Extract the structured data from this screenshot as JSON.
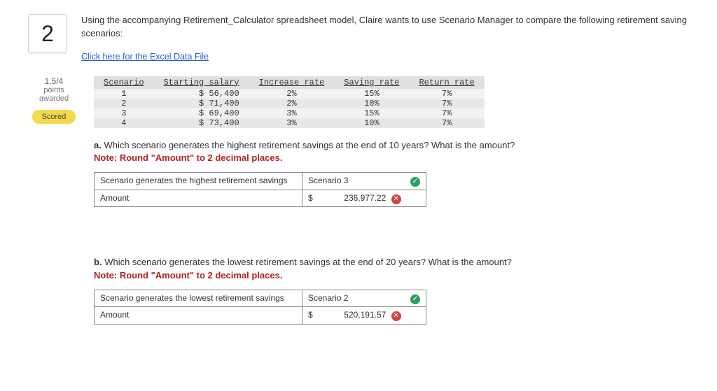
{
  "question_number": "2",
  "intro": "Using the accompanying Retirement_Calculator spreadsheet model, Claire wants to use Scenario Manager to compare the following retirement saving scenarios:",
  "excel_link": "Click here for the Excel Data File",
  "points": {
    "value": "1.5/4",
    "label": "points awarded"
  },
  "scored_label": "Scored",
  "scenario_table": {
    "headers": [
      "Scenario",
      "Starting salary",
      "Increase rate",
      "Saving rate",
      "Return rate"
    ],
    "rows": [
      {
        "n": "1",
        "sal": "$ 56,400",
        "inc": "2%",
        "sav": "15%",
        "ret": "7%"
      },
      {
        "n": "2",
        "sal": "$ 71,400",
        "inc": "2%",
        "sav": "10%",
        "ret": "7%"
      },
      {
        "n": "3",
        "sal": "$ 69,400",
        "inc": "3%",
        "sav": "15%",
        "ret": "7%"
      },
      {
        "n": "4",
        "sal": "$ 73,400",
        "inc": "3%",
        "sav": "10%",
        "ret": "7%"
      }
    ]
  },
  "part_a": {
    "label": "a.",
    "text": "Which scenario generates the highest retirement savings at the end of 10 years? What is the amount?",
    "note": "Note: Round \"Amount\" to 2 decimal places.",
    "rows": {
      "desc1": "Scenario generates the highest retirement savings",
      "val1": "Scenario 3",
      "val1_ok": true,
      "desc2": "Amount",
      "currency": "$",
      "val2": "236,977.22",
      "val2_ok": false
    }
  },
  "part_b": {
    "label": "b.",
    "text": "Which scenario generates the lowest retirement savings at the end of 20 years? What is the amount?",
    "note": "Note: Round \"Amount\" to 2 decimal places.",
    "rows": {
      "desc1": "Scenario generates the lowest retirement savings",
      "val1": "Scenario 2",
      "val1_ok": true,
      "desc2": "Amount",
      "currency": "$",
      "val2": "520,191.57",
      "val2_ok": false
    }
  }
}
